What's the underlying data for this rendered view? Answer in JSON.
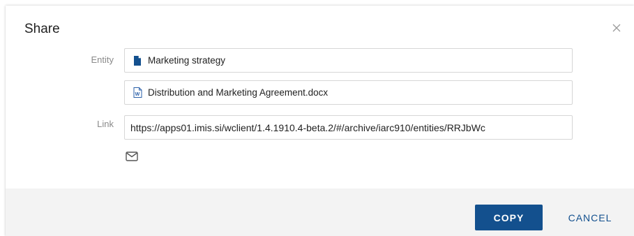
{
  "dialog": {
    "title": "Share",
    "close_icon": "close-icon"
  },
  "entity": {
    "label": "Entity",
    "items": [
      {
        "icon": "document-icon",
        "text": "Marketing strategy"
      },
      {
        "icon": "word-file-icon",
        "text": "Distribution and Marketing Agreement.docx"
      }
    ]
  },
  "link": {
    "label": "Link",
    "value": "https://apps01.imis.si/wclient/1.4.1910.4-beta.2/#/archive/iarc910/entities/RRJbWc",
    "mail_icon": "mail-icon"
  },
  "footer": {
    "copy_label": "COPY",
    "cancel_label": "CANCEL"
  },
  "colors": {
    "primary": "#13508e",
    "footer_bg": "#f3f3f3",
    "label": "#8a8a8a"
  }
}
